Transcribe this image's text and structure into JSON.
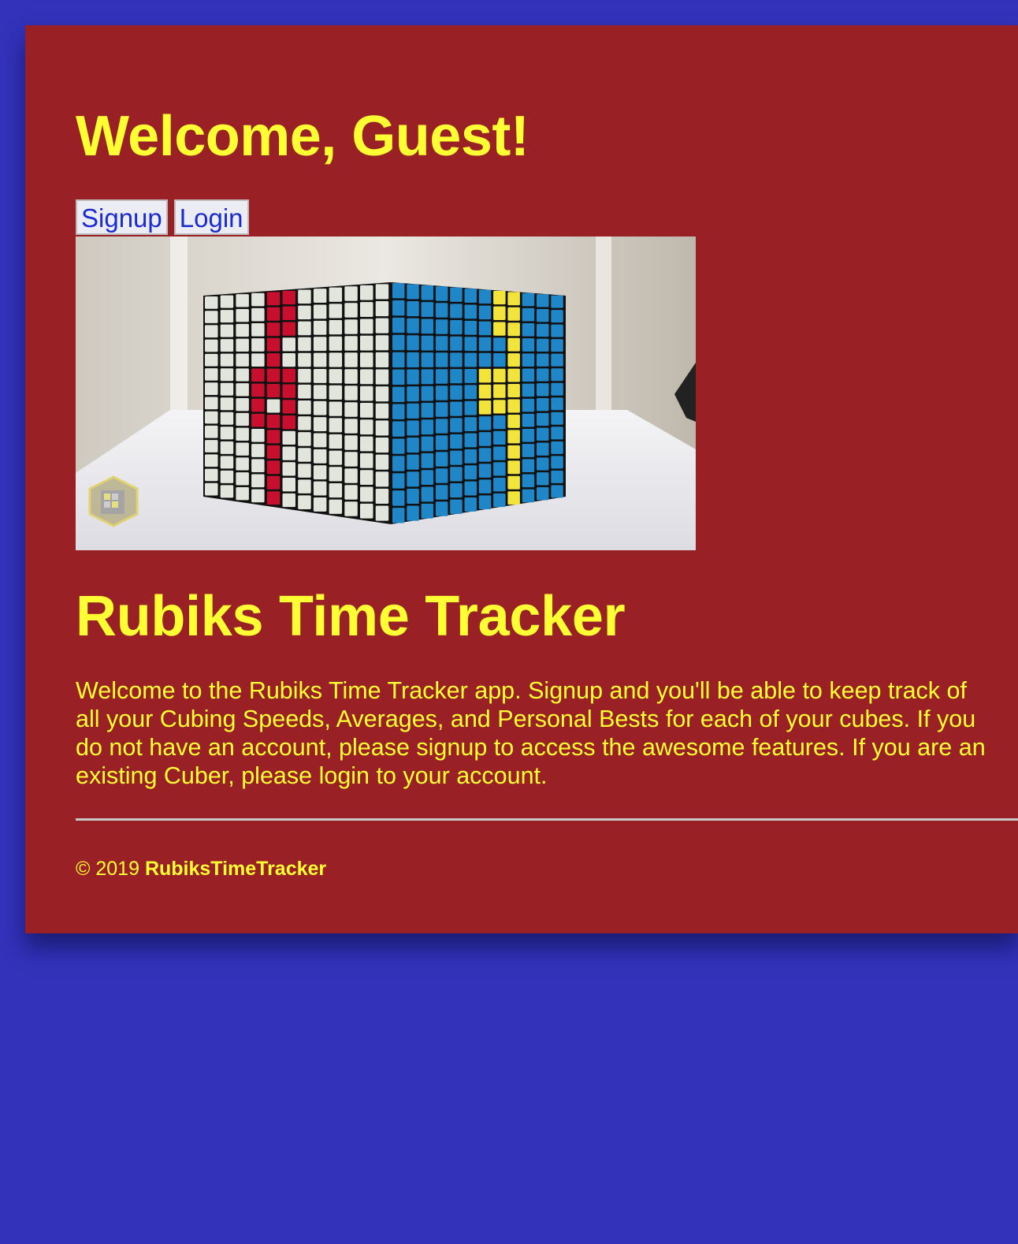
{
  "header": {
    "welcome": "Welcome, Guest!"
  },
  "nav": {
    "signup_label": "Signup",
    "login_label": "Login"
  },
  "hero": {
    "image_alt": "Stacked Rubik's cubes forming a large cube with red and yellow patterns"
  },
  "main": {
    "title": "Rubiks Time Tracker",
    "intro": "Welcome to the Rubiks Time Tracker app. Signup and you'll be able to keep track of all your Cubing Speeds, Averages, and Personal Bests for each of your cubes. If you do not have an account, please signup to access the awesome features. If you are an existing Cuber, please login to your account."
  },
  "footer": {
    "copyright": "© 2019",
    "brand": "RubiksTimeTracker"
  },
  "colors": {
    "page_background": "#3232bb",
    "card_background": "#992024",
    "heading_text": "#ffff33",
    "link_text": "#1a2bd0",
    "button_background": "#ececf5"
  }
}
